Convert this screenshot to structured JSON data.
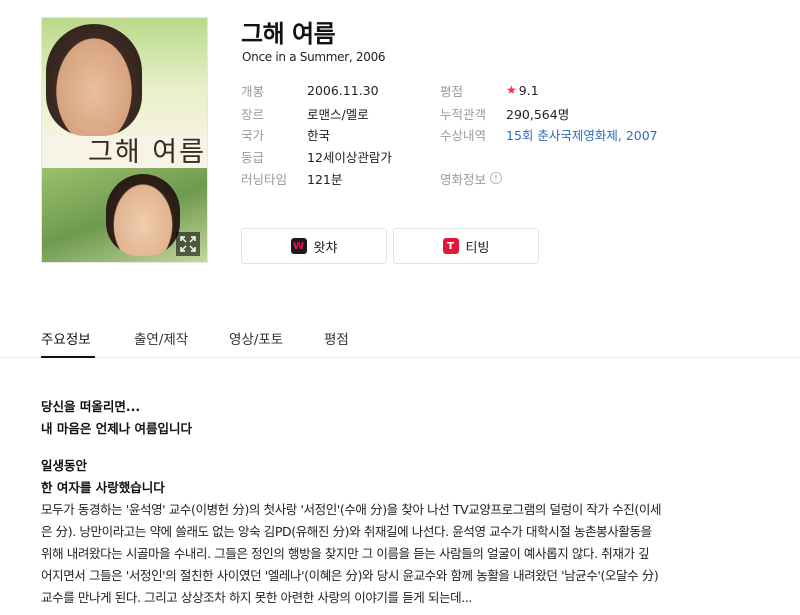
{
  "movie": {
    "title": "그해 여름",
    "subtitle": "Once in a Summer, 2006",
    "poster_title": "그해 여름"
  },
  "info_left": [
    {
      "label": "개봉",
      "value": "2006.11.30"
    },
    {
      "label": "장르",
      "value": "로맨스/멜로"
    },
    {
      "label": "국가",
      "value": "한국"
    },
    {
      "label": "등급",
      "value": "12세이상관람가"
    },
    {
      "label": "러닝타임",
      "value": "121분"
    }
  ],
  "info_right": {
    "rating_label": "평점",
    "rating_value": "9.1",
    "audience_label": "누적관객",
    "audience_value": "290,564명",
    "award_label": "수상내역",
    "award_value": "15회 춘사국제영화제, 2007",
    "info_label": "영화정보"
  },
  "ott": [
    {
      "name": "왓챠",
      "logo_text": "W",
      "logo_color": "#ff0558",
      "logo_bg": "#1a1a1a"
    },
    {
      "name": "티빙",
      "logo_text": "T",
      "logo_color": "#ffffff",
      "logo_bg": "#e5153a"
    }
  ],
  "tabs": [
    "주요정보",
    "출연/제작",
    "영상/포토",
    "평점"
  ],
  "synopsis": {
    "line1": "당신을 떠올리면...",
    "line2": "내 마음은 언제나 여름입니다",
    "line3": "일생동안",
    "line4": "한 여자를 사랑했습니다",
    "para": [
      "모두가 동경하는 '윤석영' 교수(이병헌 分)의 첫사랑 '서정인'(수애 分)을 찾아 나선 TV교양프로그램의 덜렁이 작가 수진(이세",
      "은 分). 낭만이라고는 약에 쓸래도 없는 앙숙 김PD(유해진 分)와 취재길에 나선다. 윤석영 교수가 대학시절 농촌봉사활동을",
      "위해 내려왔다는 시골마을 수내리. 그들은 정인의 행방을 찾지만 그 이름을 듣는 사람들의 얼굴이 예사롭지 않다. 취재가 깊",
      "어지면서 그들은 '서정인'의 절친한 사이였던 '엘레나'(이혜은 分)와 당시 윤교수와 함께 농활을 내려왔던 '남균수'(오달수 分)",
      "교수를 만나게 된다. 그리고 상상조차 하지 못한 아련한 사랑의 이야기를 듣게 되는데..."
    ]
  },
  "colors": {
    "accent_link": "#2b6cc4",
    "star": "#ff2e3f"
  }
}
